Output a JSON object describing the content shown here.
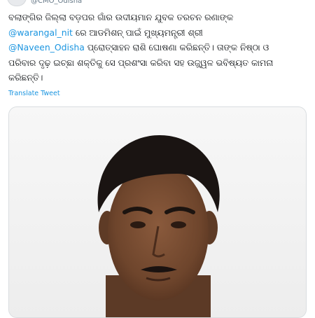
{
  "tweet": {
    "author_handle": "@CMO_Odisha",
    "text_line_1": "ବଲାଙ୍ଗିର ଜିଲ୍ଲା ବଡ଼ପର ଗାଁର ଉଦୀୟମାନ ଯୁବକ ତରଚନ ରଣାଙ୍କ",
    "mention_1": "@warangal_nit",
    "text_line_2_rest": " ରେ ଆଡମିଶନ୍ ପାଇଁ ମୁଖ୍ୟମନ୍ତ୍ରୀ ଶ୍ରୀ",
    "mention_2": "@Naveen_Odisha",
    "text_line_3_rest": " ପ୍ରୋତ୍ସାହନ ରାଶି ଘୋଷଣା କରିଛନ୍ତି। ତାଙ୍କ ନିଷ୍ଠା ଓ",
    "text_line_4": "ପରିବାର ଦୃଢ଼ ଇଚ୍ଛା ଶକ୍ତିକୁ ସେ ପ୍ରଶଂସା କରିବା ସହ ଉଜ୍ଜ୍ୱଳ ଭବିଷ୍ୟତ କାମନା",
    "text_line_5": "କରିଛନ୍ତି।",
    "translate_label": "Translate Tweet"
  },
  "colors": {
    "link": "#1b95e0",
    "text": "#14171a",
    "muted": "#657786"
  }
}
